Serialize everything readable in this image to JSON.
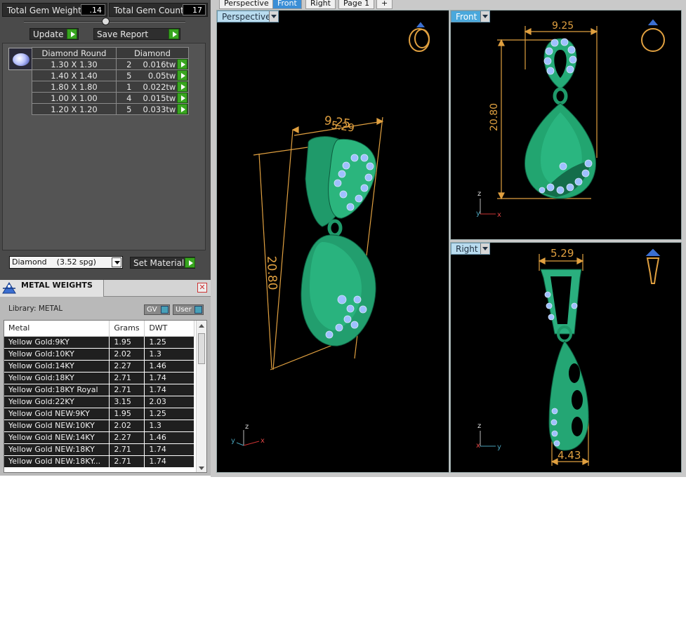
{
  "totals": {
    "weight_label": "Total Gem Weight",
    "weight_value": ".14",
    "count_label": "Total Gem Count",
    "count_value": "17"
  },
  "actions": {
    "update_label": "Update",
    "save_label": "Save Report"
  },
  "gem_table": {
    "headers": [
      "Diamond Round",
      "Diamond"
    ],
    "rows": [
      {
        "size": "1.30 X 1.30",
        "count": "2",
        "tw": "0.016tw"
      },
      {
        "size": "1.40 X 1.40",
        "count": "5",
        "tw": "0.05tw"
      },
      {
        "size": "1.80 X 1.80",
        "count": "1",
        "tw": "0.022tw"
      },
      {
        "size": "1.00 X 1.00",
        "count": "4",
        "tw": "0.015tw"
      },
      {
        "size": "1.20 X 1.20",
        "count": "5",
        "tw": "0.033tw"
      }
    ]
  },
  "material": {
    "selected": "Diamond    (3.52 spg)",
    "set_label": "Set Material"
  },
  "metal": {
    "title": "METAL WEIGHTS",
    "close": "✕",
    "library": "Library: METAL",
    "gv_label": "GV",
    "user_label": "User",
    "headers": [
      "Metal",
      "Grams",
      "DWT"
    ],
    "rows": [
      {
        "name": "Yellow Gold:9KY",
        "grams": "1.95",
        "dwt": "1.25"
      },
      {
        "name": "Yellow Gold:10KY",
        "grams": "2.02",
        "dwt": "1.3"
      },
      {
        "name": "Yellow Gold:14KY",
        "grams": "2.27",
        "dwt": "1.46"
      },
      {
        "name": "Yellow Gold:18KY",
        "grams": "2.71",
        "dwt": "1.74"
      },
      {
        "name": "Yellow Gold:18KY Royal",
        "grams": "2.71",
        "dwt": "1.74"
      },
      {
        "name": "Yellow Gold:22KY",
        "grams": "3.15",
        "dwt": "2.03"
      },
      {
        "name": "Yellow Gold NEW:9KY",
        "grams": "1.95",
        "dwt": "1.25"
      },
      {
        "name": "Yellow Gold NEW:10KY",
        "grams": "2.02",
        "dwt": "1.3"
      },
      {
        "name": "Yellow Gold NEW:14KY",
        "grams": "2.27",
        "dwt": "1.46"
      },
      {
        "name": "Yellow Gold NEW:18KY",
        "grams": "2.71",
        "dwt": "1.74"
      },
      {
        "name": "Yellow Gold NEW:18KY...",
        "grams": "2.71",
        "dwt": "1.74"
      }
    ]
  },
  "tabs": [
    "Perspective",
    "Front",
    "Right",
    "Page 1",
    "+"
  ],
  "viewports": {
    "perspective": {
      "label": "Perspective",
      "dim_width": "9.25",
      "dim_width2": "5.29",
      "dim_height": "20.80"
    },
    "front": {
      "label": "Front",
      "dim_width": "9.25",
      "dim_height": "20.80"
    },
    "right": {
      "label": "Right",
      "dim_top": "5.29",
      "dim_bottom": "4.43"
    }
  },
  "axes": {
    "x": "x",
    "y": "y",
    "z": "z"
  },
  "colors": {
    "metal": "#27b07a",
    "dimension": "#e0a040",
    "panel": "#4a4a4a",
    "accent": "#3a8ed6"
  }
}
